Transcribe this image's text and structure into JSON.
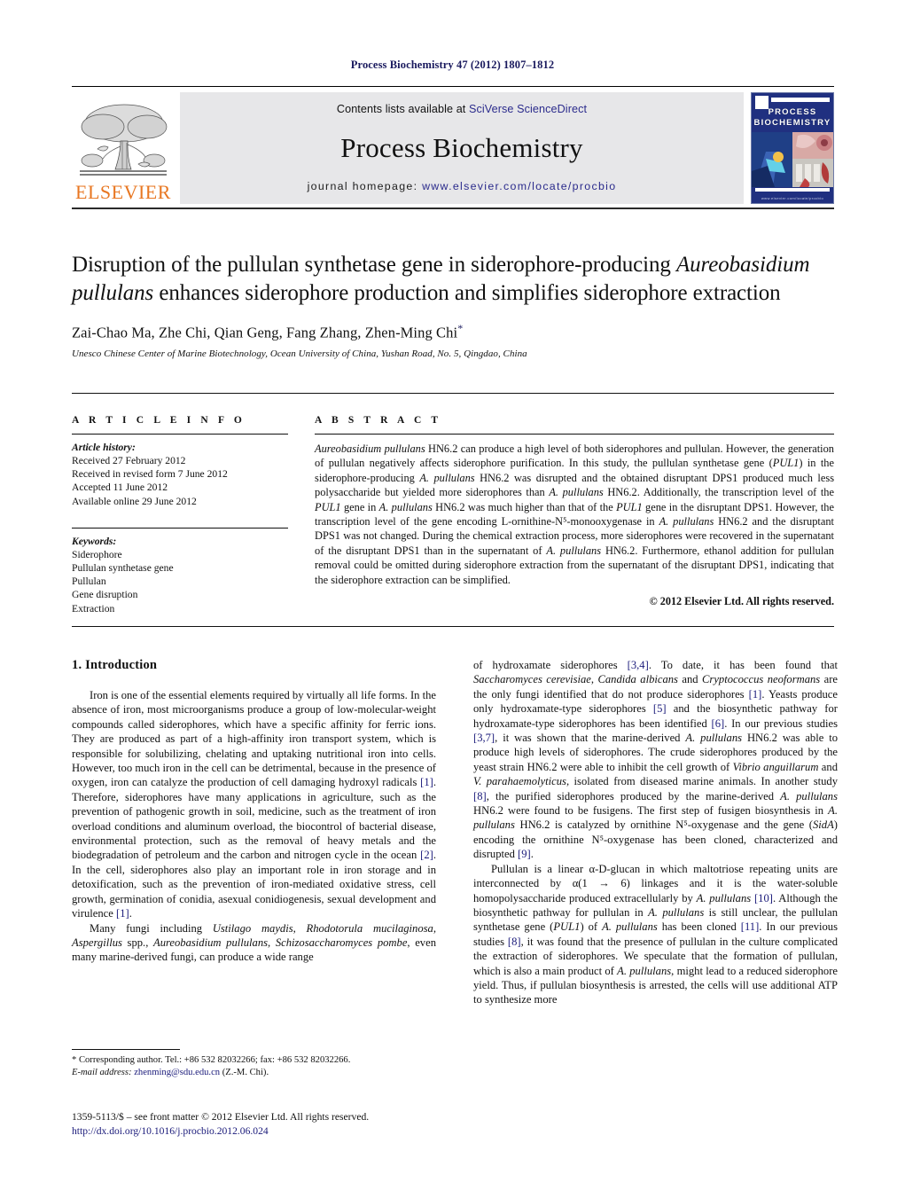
{
  "running_head": "Process Biochemistry 47 (2012) 1807–1812",
  "masthead": {
    "contents_prefix": "Contents lists available at ",
    "contents_link": "SciVerse ScienceDirect",
    "journal_name": "Process Biochemistry",
    "homepage_prefix": "journal homepage: ",
    "homepage_url": "www.elsevier.com/locate/procbio",
    "publisher": "ELSEVIER",
    "cover_title_line1": "PROCESS",
    "cover_title_line2": "BIOCHEMISTRY",
    "cover_footer": "www.elsevier.com/locate/procbio"
  },
  "article": {
    "title_line1": "Disruption of the pullulan synthetase gene in siderophore-producing",
    "title_italic": "Aureobasidium pullulans",
    "title_line2_rest": " enhances siderophore production and simplifies",
    "title_line3": "siderophore extraction",
    "authors": "Zai-Chao Ma, Zhe Chi, Qian Geng, Fang Zhang, Zhen-Ming Chi",
    "author_star": "*",
    "affiliation": "Unesco Chinese Center of Marine Biotechnology, Ocean University of China, Yushan Road, No. 5, Qingdao, China"
  },
  "info": {
    "heading": "A R T I C L E   I N F O",
    "history_label": "Article history:",
    "history": [
      "Received 27 February 2012",
      "Received in revised form 7 June 2012",
      "Accepted 11 June 2012",
      "Available online 29 June 2012"
    ],
    "keywords_label": "Keywords:",
    "keywords": [
      "Siderophore",
      "Pullulan synthetase gene",
      "Pullulan",
      "Gene disruption",
      "Extraction"
    ]
  },
  "abstract": {
    "heading": "A B S T R A C T",
    "text_parts": [
      {
        "t": "i",
        "v": "Aureobasidium pullulans"
      },
      {
        "t": "n",
        "v": " HN6.2 can produce a high level of both siderophores and pullulan. However, the generation of pullulan negatively affects siderophore purification. In this study, the pullulan synthetase gene ("
      },
      {
        "t": "i",
        "v": "PUL1"
      },
      {
        "t": "n",
        "v": ") in the siderophore-producing "
      },
      {
        "t": "i",
        "v": "A. pullulans"
      },
      {
        "t": "n",
        "v": " HN6.2 was disrupted and the obtained disruptant DPS1 produced much less polysaccharide but yielded more siderophores than "
      },
      {
        "t": "i",
        "v": "A. pullulans"
      },
      {
        "t": "n",
        "v": " HN6.2. Additionally, the transcription level of the "
      },
      {
        "t": "i",
        "v": "PUL1"
      },
      {
        "t": "n",
        "v": " gene in "
      },
      {
        "t": "i",
        "v": "A. pullulans"
      },
      {
        "t": "n",
        "v": " HN6.2 was much higher than that of the "
      },
      {
        "t": "i",
        "v": "PUL1"
      },
      {
        "t": "n",
        "v": " gene in the disruptant DPS1. However, the transcription level of the gene encoding L-ornithine-N⁵-monooxygenase in "
      },
      {
        "t": "i",
        "v": "A. pullulans"
      },
      {
        "t": "n",
        "v": " HN6.2 and the disruptant DPS1 was not changed. During the chemical extraction process, more siderophores were recovered in the supernatant of the disruptant DPS1 than in the supernatant of "
      },
      {
        "t": "i",
        "v": "A. pullulans"
      },
      {
        "t": "n",
        "v": " HN6.2. Furthermore, ethanol addition for pullulan removal could be omitted during siderophore extraction from the supernatant of the disruptant DPS1, indicating that the siderophore extraction can be simplified."
      }
    ],
    "copyright": "© 2012 Elsevier Ltd. All rights reserved."
  },
  "body": {
    "section_number_title": "1.  Introduction",
    "left_paragraphs": [
      [
        {
          "t": "n",
          "v": "Iron is one of the essential elements required by virtually all life forms. In the absence of iron, most microorganisms produce a group of low-molecular-weight compounds called siderophores, which have a specific affinity for ferric ions. They are produced as part of a high-affinity iron transport system, which is responsible for solubilizing, chelating and uptaking nutritional iron into cells. However, too much iron in the cell can be detrimental, because in the presence of oxygen, iron can catalyze the production of cell damaging hydroxyl radicals "
        },
        {
          "t": "r",
          "v": "[1]"
        },
        {
          "t": "n",
          "v": ". Therefore, siderophores have many applications in agriculture, such as the prevention of pathogenic growth in soil, medicine, such as the treatment of iron overload conditions and aluminum overload, the biocontrol of bacterial disease, environmental protection, such as the removal of heavy metals and the biodegradation of petroleum and the carbon and nitrogen cycle in the ocean "
        },
        {
          "t": "r",
          "v": "[2]"
        },
        {
          "t": "n",
          "v": ". In the cell, siderophores also play an important role in iron storage and in detoxification, such as the prevention of iron-mediated oxidative stress, cell growth, germination of conidia, asexual conidiogenesis, sexual development and virulence "
        },
        {
          "t": "r",
          "v": "[1]"
        },
        {
          "t": "n",
          "v": "."
        }
      ],
      [
        {
          "t": "n",
          "v": "Many fungi including "
        },
        {
          "t": "i",
          "v": "Ustilago maydis"
        },
        {
          "t": "n",
          "v": ", "
        },
        {
          "t": "i",
          "v": "Rhodotorula mucilaginosa"
        },
        {
          "t": "n",
          "v": ", "
        },
        {
          "t": "i",
          "v": "Aspergillus"
        },
        {
          "t": "n",
          "v": " spp., "
        },
        {
          "t": "i",
          "v": "Aureobasidium pullulans"
        },
        {
          "t": "n",
          "v": ", "
        },
        {
          "t": "i",
          "v": "Schizosaccharomyces pombe"
        },
        {
          "t": "n",
          "v": ", even many marine-derived fungi, can produce a wide range"
        }
      ]
    ],
    "right_paragraphs": [
      [
        {
          "t": "n",
          "v": "of hydroxamate siderophores "
        },
        {
          "t": "r",
          "v": "[3,4]"
        },
        {
          "t": "n",
          "v": ". To date, it has been found that "
        },
        {
          "t": "i",
          "v": "Saccharomyces cerevisiae"
        },
        {
          "t": "n",
          "v": ", "
        },
        {
          "t": "i",
          "v": "Candida albicans"
        },
        {
          "t": "n",
          "v": " and "
        },
        {
          "t": "i",
          "v": "Cryptococcus neoformans"
        },
        {
          "t": "n",
          "v": " are the only fungi identified that do not produce siderophores "
        },
        {
          "t": "r",
          "v": "[1]"
        },
        {
          "t": "n",
          "v": ". Yeasts produce only hydroxamate-type siderophores "
        },
        {
          "t": "r",
          "v": "[5]"
        },
        {
          "t": "n",
          "v": " and the biosynthetic pathway for hydroxamate-type siderophores has been identified "
        },
        {
          "t": "r",
          "v": "[6]"
        },
        {
          "t": "n",
          "v": ". In our previous studies "
        },
        {
          "t": "r",
          "v": "[3,7]"
        },
        {
          "t": "n",
          "v": ", it was shown that the marine-derived "
        },
        {
          "t": "i",
          "v": "A. pullulans"
        },
        {
          "t": "n",
          "v": " HN6.2 was able to produce high levels of siderophores. The crude siderophores produced by the yeast strain HN6.2 were able to inhibit the cell growth of "
        },
        {
          "t": "i",
          "v": "Vibrio anguillarum"
        },
        {
          "t": "n",
          "v": " and "
        },
        {
          "t": "i",
          "v": "V. parahaemolyticus"
        },
        {
          "t": "n",
          "v": ", isolated from diseased marine animals. In another study "
        },
        {
          "t": "r",
          "v": "[8]"
        },
        {
          "t": "n",
          "v": ", the purified siderophores produced by the marine-derived "
        },
        {
          "t": "i",
          "v": "A. pullulans"
        },
        {
          "t": "n",
          "v": " HN6.2 were found to be fusigens. The first step of fusigen biosynthesis in "
        },
        {
          "t": "i",
          "v": "A. pullulans"
        },
        {
          "t": "n",
          "v": " HN6.2 is catalyzed by ornithine N⁵-oxygenase and the gene ("
        },
        {
          "t": "i",
          "v": "SidA"
        },
        {
          "t": "n",
          "v": ") encoding the ornithine N⁵-oxygenase has been cloned, characterized and disrupted "
        },
        {
          "t": "r",
          "v": "[9]"
        },
        {
          "t": "n",
          "v": "."
        }
      ],
      [
        {
          "t": "n",
          "v": "Pullulan is a linear α-D-glucan in which maltotriose repeating units are interconnected by α(1 → 6) linkages and it is the water-soluble homopolysaccharide produced extracellularly by "
        },
        {
          "t": "i",
          "v": "A. pullulans"
        },
        {
          "t": "n",
          "v": " "
        },
        {
          "t": "r",
          "v": "[10]"
        },
        {
          "t": "n",
          "v": ". Although the biosynthetic pathway for pullulan in "
        },
        {
          "t": "i",
          "v": "A. pullulans"
        },
        {
          "t": "n",
          "v": " is still unclear, the pullulan synthetase gene ("
        },
        {
          "t": "i",
          "v": "PUL1"
        },
        {
          "t": "n",
          "v": ") of "
        },
        {
          "t": "i",
          "v": "A. pullulans"
        },
        {
          "t": "n",
          "v": " has been cloned "
        },
        {
          "t": "r",
          "v": "[11]"
        },
        {
          "t": "n",
          "v": ". In our previous studies "
        },
        {
          "t": "r",
          "v": "[8]"
        },
        {
          "t": "n",
          "v": ", it was found that the presence of pullulan in the culture complicated the extraction of siderophores. We speculate that the formation of pullulan, which is also a main product of "
        },
        {
          "t": "i",
          "v": "A. pullulans"
        },
        {
          "t": "n",
          "v": ", might lead to a reduced siderophore yield. Thus, if pullulan biosynthesis is arrested, the cells will use additional ATP to synthesize more"
        }
      ]
    ]
  },
  "footer": {
    "corresponding": "*  Corresponding author. Tel.: +86 532 82032266; fax: +86 532 82032266.",
    "email_label": "E-mail address:",
    "email": "zhenming@sdu.edu.cn",
    "email_suffix": " (Z.-M. Chi).",
    "imprint": "1359-5113/$ – see front matter © 2012 Elsevier Ltd. All rights reserved.",
    "doi": "http://dx.doi.org/10.1016/j.procbio.2012.06.024"
  }
}
